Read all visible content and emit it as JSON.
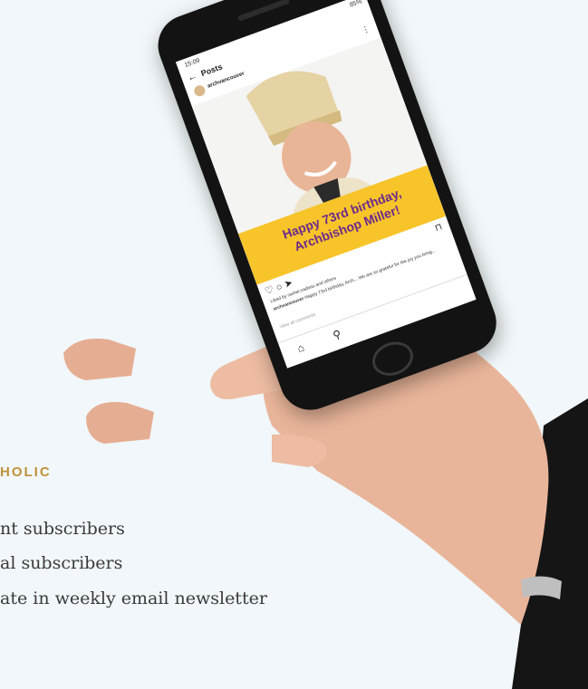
{
  "heading": "HOLIC",
  "stats": [
    "nt subscribers",
    "al subscribers",
    "ate in weekly email newsletter"
  ],
  "phone": {
    "status_time": "15:09",
    "battery": "85%",
    "nav_title": "Posts",
    "username": "archvancouver",
    "banner_line1": "Happy 73rd birthday,",
    "banner_line2": "Archbishop Miller!",
    "liked_by": "Liked by rachel.nadeau and others",
    "caption_user": "archvancouver",
    "caption": "Happy 73rd birthday, Arch... We are so grateful for the joy you bring...",
    "comments": "View all comments"
  },
  "colors": {
    "background": "#f1f7fa",
    "heading": "#c0913a",
    "banner": "#f7c42a",
    "banner_text": "#6b2a8c"
  }
}
